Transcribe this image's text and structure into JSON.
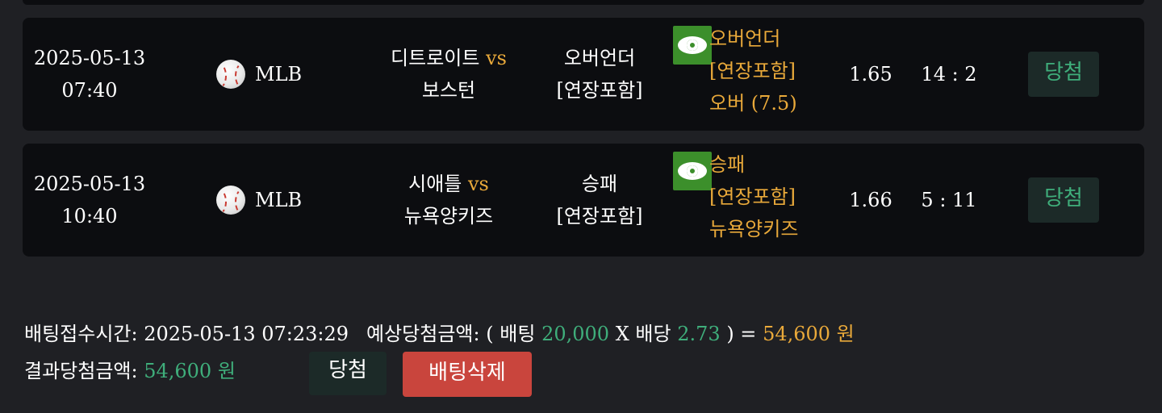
{
  "bets": [
    {
      "date": "2025-05-13",
      "time": "07:40",
      "league": "MLB",
      "league_icon": "baseball-icon",
      "home_team": "디트로이트",
      "vs": "vs",
      "away_team": "보스턴",
      "market_line1": "오버언더",
      "market_line2": "[연장포함]",
      "pick_line1": "오버언더",
      "pick_line2": "[연장포함]",
      "pick_line3": "오버 (7.5)",
      "odds": "1.65",
      "score": "14 : 2",
      "result": "당첨"
    },
    {
      "date": "2025-05-13",
      "time": "10:40",
      "league": "MLB",
      "league_icon": "baseball-icon",
      "home_team": "시애틀",
      "vs": "vs",
      "away_team": "뉴욕양키즈",
      "market_line1": "승패",
      "market_line2": "[연장포함]",
      "pick_line1": "승패",
      "pick_line2": "[연장포함]",
      "pick_line3": "뉴욕양키즈",
      "odds": "1.66",
      "score": "5 : 11",
      "result": "당첨"
    }
  ],
  "summary": {
    "bet_time_label": "배팅접수시간:",
    "bet_time": "2025-05-13 07:23:29",
    "expected_label": "예상당첨금액:",
    "paren_open": "(",
    "bet_label": "배팅",
    "bet_amount": "20,000",
    "times": "X",
    "odds_label": "배당",
    "total_odds": "2.73",
    "paren_close": ") =",
    "expected_amount": "54,600 원",
    "result_label": "결과당첨금액:",
    "result_amount": "54,600 원",
    "win_button": "당첨",
    "delete_button": "배팅삭제"
  },
  "colors": {
    "background": "#1f2024",
    "row_background": "#0c0d10",
    "accent_orange": "#e9a93a",
    "accent_green": "#3fae7b",
    "eye_button": "#3c8f2b",
    "delete_button": "#c9453d"
  }
}
